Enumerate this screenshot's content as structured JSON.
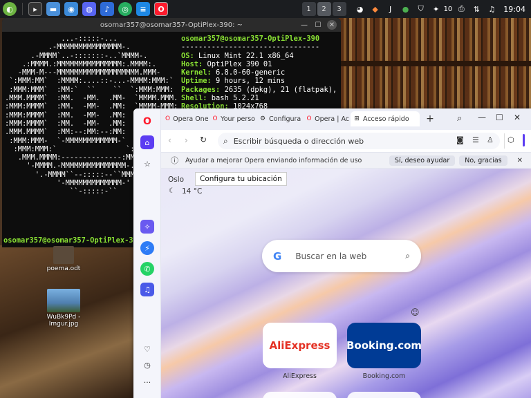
{
  "taskbar": {
    "workspaces": [
      "1",
      "2",
      "3"
    ],
    "battery": "10",
    "clock": "19:04"
  },
  "terminal": {
    "title": "osomar357@osomar357-OptiPlex-390: ~",
    "ascii": "             ...-:::::-...\n          .-MMMMMMMMMMMMMMM-.\n      .-MMMM`..-:::::::-..`MMMM-.\n    .:MMMM.:MMMMMMMMMMMMMMM:.MMMM:.\n   -MMM-M---MMMMMMMMMMMMMMMMMMM.MMM-\n `:MMM:MM`  :MMMM:....::-...-MMMM:MMM:`\n :MMM:MMM`  :MM:`  ``    ``  `:MMM:MMM:\n.MMM.MMMM`  :MM.  -MM.  .MM-  `MMMM.MMM.\n:MMM:MMMM`  :MM.  -MM-  .MM:  `MMMM-MMM:\n:MMM:MMMM`  :MM.  -MM-  .MM:  `MMMM:MMM:\n:MMM:MMMM`  :MM.  -MM-  .MM:  `MMMM-MMM:\n.MMM.MMMM`  :MM:--:MM:--:MM:  `MMMM.MMM.\n :MMM:MMM-  `-MMMMMMMMMMMM-`  -MMM-MMM:\n  :MMM:MMM:`                `:MMM:MMM:\n   .MMM.MMMM:--------------:MMMM.MMM.\n     '-MMMM.-MMMMMMMMMMMMMMM-.MMMM-'\n       '.-MMMM``--:::::--``MMMM-.'\n            '-MMMMMMMMMMMMM-'\n               ``-:::::-``",
    "user_host": "osomar357@osomar357-OptiPlex-390",
    "separator": "--------------------------------",
    "info": [
      {
        "key": "OS",
        "value": "Linux Mint 22.1 x86_64"
      },
      {
        "key": "Host",
        "value": "OptiPlex 390 01"
      },
      {
        "key": "Kernel",
        "value": "6.8.0-60-generic"
      },
      {
        "key": "Uptime",
        "value": "9 hours, 12 mins"
      },
      {
        "key": "Packages",
        "value": "2635 (dpkg), 21 (flatpak),"
      },
      {
        "key": "Shell",
        "value": "bash 5.2.21"
      },
      {
        "key": "Resolution",
        "value": "1024x768"
      }
    ],
    "prompt": "osomar357@osomar357-OptiPlex-390"
  },
  "desktop": {
    "icons": [
      {
        "label": "poema.odt"
      },
      {
        "label": "WuBk9Pd - Imgur.jpg"
      }
    ]
  },
  "opera": {
    "tabs": [
      {
        "label": "Opera One"
      },
      {
        "label": "Your perso"
      },
      {
        "label": "Configura"
      },
      {
        "label": "Opera | Ac"
      },
      {
        "label": "Acceso rápido"
      }
    ],
    "new_tab_label": "+",
    "address_placeholder": "Escribir búsqueda o dirección web",
    "infobar": {
      "text": "Ayudar a mejorar Opera enviando información de uso",
      "accept": "Sí, deseo ayudar",
      "decline": "No, gracias"
    },
    "weather": {
      "city": "Oslo",
      "tooltip": "Configura tu ubicación",
      "temp": "14 °C"
    },
    "search_placeholder": "Buscar en la web",
    "speed_dials": [
      {
        "label": "AliExpress",
        "logo": "AliExpress",
        "color": "#e43225"
      },
      {
        "label": "Booking.com",
        "logo": "Booking.com",
        "color": "#003b95"
      }
    ],
    "colors": {
      "accent": "#5b3cf2",
      "opera_red": "#ff1b2d"
    }
  }
}
